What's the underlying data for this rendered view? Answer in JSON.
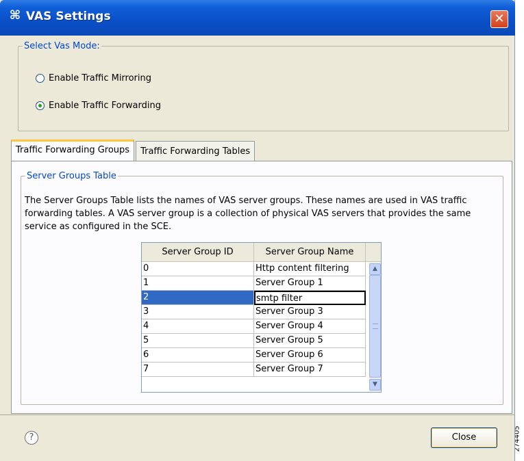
{
  "window": {
    "title": "VAS Settings",
    "app_icon": "vas-icon",
    "close_glyph": "✕"
  },
  "mode_group": {
    "legend": "Select Vas Mode:",
    "options": [
      {
        "label": "Enable Traffic Mirroring",
        "checked": false
      },
      {
        "label": "Enable Traffic Forwarding",
        "checked": true
      }
    ]
  },
  "tabs": [
    {
      "label": "Traffic Forwarding Groups",
      "active": true
    },
    {
      "label": "Traffic Forwarding Tables",
      "active": false
    }
  ],
  "server_groups": {
    "legend": "Server Groups Table",
    "description": "The Server Groups Table lists the names of VAS server groups. These names are used in VAS traffic forwarding tables. A VAS server group is a collection of physical VAS servers that provides the same service as configured in the SCE.",
    "columns": [
      "Server Group ID",
      "Server Group Name"
    ],
    "rows": [
      {
        "id": "0",
        "name": "Http content filtering"
      },
      {
        "id": "1",
        "name": "Server Group 1"
      },
      {
        "id": "2",
        "name": "smtp filter"
      },
      {
        "id": "3",
        "name": "Server Group 3"
      },
      {
        "id": "4",
        "name": "Server Group 4"
      },
      {
        "id": "5",
        "name": "Server Group 5"
      },
      {
        "id": "6",
        "name": "Server Group 6"
      },
      {
        "id": "7",
        "name": "Server Group 7"
      }
    ],
    "selected_row": 2
  },
  "footer": {
    "help_glyph": "?",
    "close_label": "Close",
    "side_code": "274405"
  }
}
